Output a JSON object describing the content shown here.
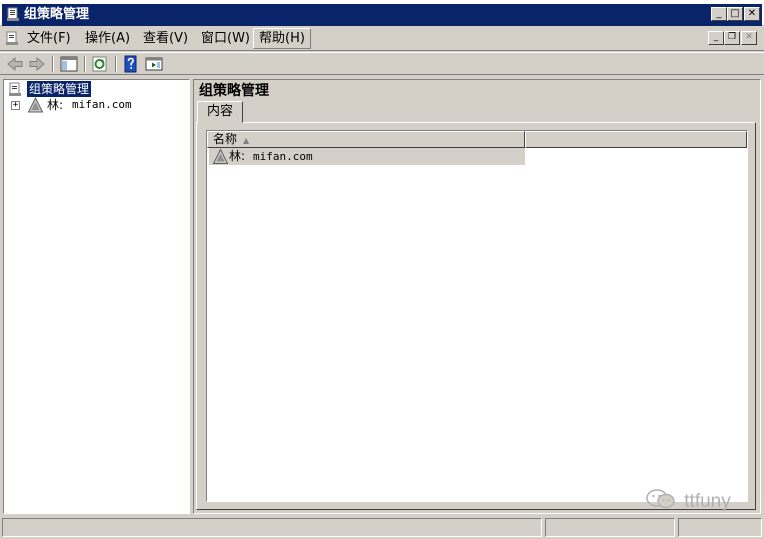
{
  "window": {
    "title": "组策略管理",
    "controls": {
      "minimize": "_",
      "maximize": "□",
      "close": "✕"
    }
  },
  "menu": {
    "items": [
      {
        "label": "文件(F)"
      },
      {
        "label": "操作(A)"
      },
      {
        "label": "查看(V)"
      },
      {
        "label": "窗口(W)"
      },
      {
        "label": "帮助(H)"
      }
    ],
    "active_item": "帮助(H)",
    "mdi_controls": {
      "minimize": "_",
      "restore": "❐",
      "close": "✕"
    }
  },
  "toolbar": {
    "icons": [
      "back-icon",
      "forward-icon",
      "show-hide-tree-icon",
      "refresh-icon",
      "help-icon",
      "console-view-icon"
    ]
  },
  "tree": {
    "root_label": "组策略管理",
    "children": [
      {
        "prefix": "林:",
        "name": "mifan.com",
        "expander": "+"
      }
    ]
  },
  "details": {
    "title": "组策略管理",
    "tab_label": "内容",
    "columns": [
      {
        "label": "名称",
        "sort": "ascending"
      },
      {
        "label": ""
      }
    ],
    "rows": [
      {
        "prefix": "林:",
        "name": "mifan.com"
      }
    ]
  },
  "watermark": {
    "text": "ttfuny"
  },
  "colors": {
    "title_bar": "#0a246a",
    "face": "#d4d0c8",
    "selection": "#0a246a"
  }
}
